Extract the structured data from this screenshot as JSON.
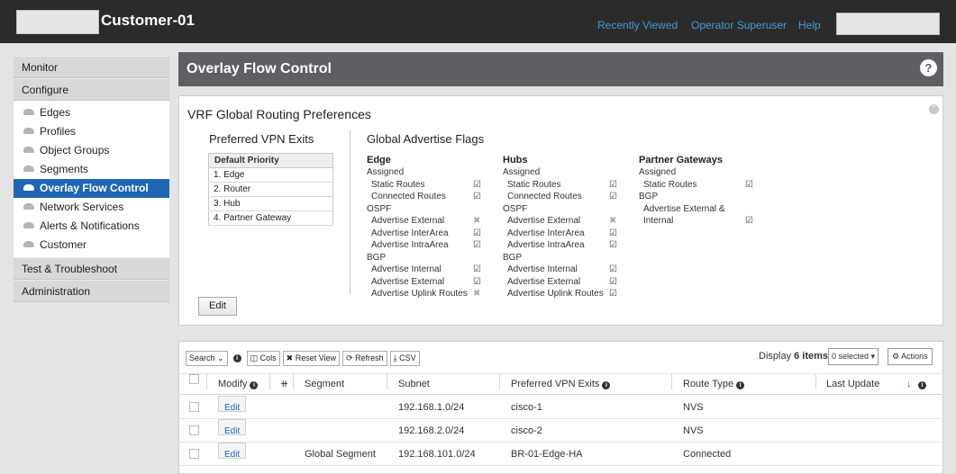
{
  "app": {
    "title": "Customer-01"
  },
  "toplinks": [
    "Recently Viewed",
    "Operator Superuser",
    "Help"
  ],
  "sidebar": {
    "monitor": "Monitor",
    "configure": "Configure",
    "items": [
      "Edges",
      "Profiles",
      "Object Groups",
      "Segments",
      "Overlay Flow Control",
      "Network Services",
      "Alerts & Notifications",
      "Customer"
    ],
    "active_index": 4,
    "test": "Test & Troubleshoot",
    "admin": "Administration"
  },
  "main": {
    "title": "Overlay Flow Control",
    "help": "?"
  },
  "vrf": {
    "title": "VRF Global Routing Preferences",
    "pve_title": "Preferred VPN Exits",
    "priority_header": "Default Priority",
    "priority": [
      "1.  Edge",
      "2.  Router",
      "3.  Hub",
      "4.  Partner Gateway"
    ],
    "gaf_title": "Global Advertise Flags",
    "edge": {
      "header": "Edge",
      "rows": [
        "Assigned",
        "Static Routes",
        "Connected Routes",
        "OSPF",
        "Advertise External",
        "Advertise InterArea",
        "Advertise IntraArea",
        "BGP",
        "Advertise Internal",
        "Advertise External",
        "Advertise Uplink Routes"
      ],
      "checks": [
        "",
        "on",
        "on",
        "",
        "off",
        "on",
        "on",
        "",
        "on",
        "on",
        "off"
      ]
    },
    "hubs": {
      "header": "Hubs",
      "rows": [
        "Assigned",
        "Static Routes",
        "Connected Routes",
        "OSPF",
        "Advertise External",
        "Advertise InterArea",
        "Advertise IntraArea",
        "BGP",
        "Advertise Internal",
        "Advertise External",
        "Advertise Uplink Routes"
      ],
      "checks": [
        "",
        "on",
        "on",
        "",
        "off",
        "on",
        "on",
        "",
        "on",
        "on",
        "on"
      ]
    },
    "partner": {
      "header": "Partner Gateways",
      "rows": [
        "Assigned",
        "Static Routes",
        "BGP",
        "Advertise External &",
        "Internal"
      ],
      "checks": [
        "",
        "on",
        "",
        "",
        "on"
      ]
    },
    "edit_label": "Edit"
  },
  "toolbar": {
    "search": "Search",
    "cols": "Cols",
    "reset": "Reset View",
    "refresh": "Refresh",
    "csv": "CSV",
    "display_prefix": "Display ",
    "display_count": "6 items.",
    "selected": "0 selected",
    "actions": "Actions"
  },
  "grid": {
    "headers": {
      "modify": "Modify",
      "segment": "Segment",
      "subnet": "Subnet",
      "vpn": "Preferred VPN Exits",
      "route_type": "Route Type",
      "last_update": "Last Update"
    },
    "edit_label": "Edit",
    "rows": [
      {
        "segment": "",
        "subnet": "192.168.1.0/24",
        "vpn": "cisco-1",
        "route_type": "NVS",
        "last_update": ""
      },
      {
        "segment": "",
        "subnet": "192.168.2.0/24",
        "vpn": "cisco-2",
        "route_type": "NVS",
        "last_update": ""
      },
      {
        "segment": "Global Segment",
        "subnet": "192.168.101.0/24",
        "vpn": "BR-01-Edge-HA",
        "route_type": "Connected",
        "last_update": ""
      }
    ]
  },
  "colors": {
    "topbar": "#2b2b2b",
    "accent": "#1f67b5",
    "link": "#3d9ad6",
    "header": "#5f5f63"
  }
}
